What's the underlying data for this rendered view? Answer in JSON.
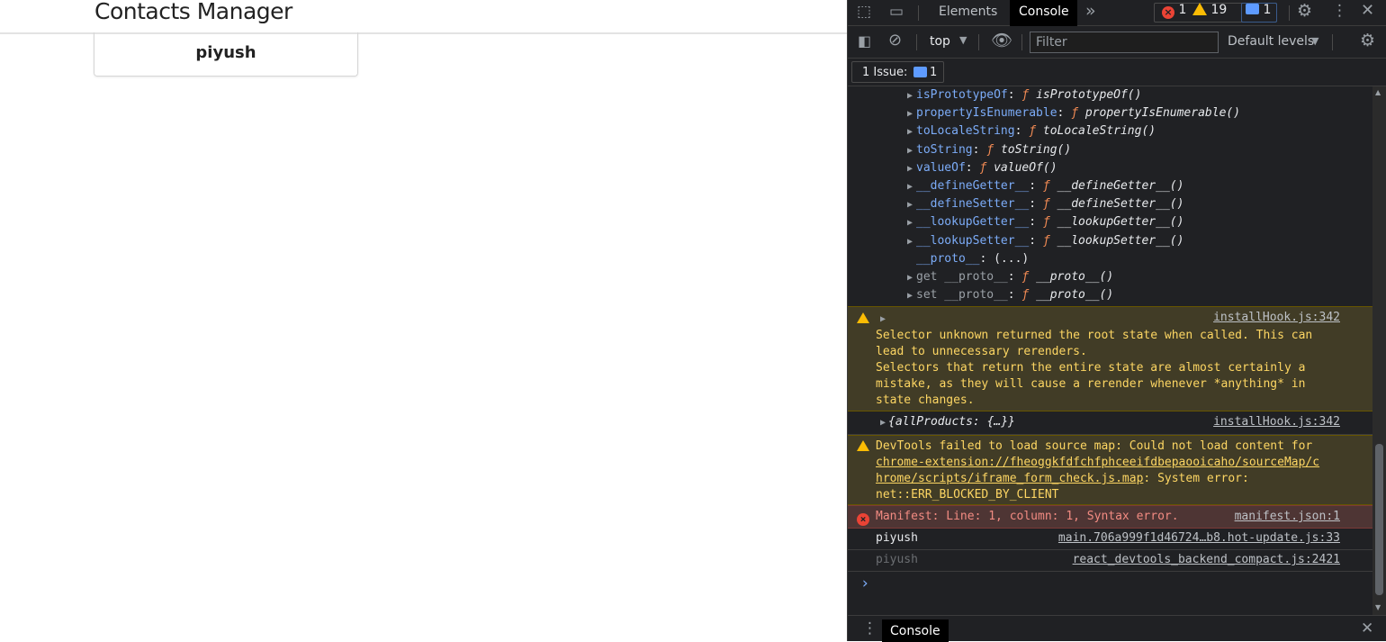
{
  "page": {
    "title": "Contacts Manager",
    "contact_name": "piyush"
  },
  "devtools": {
    "tabs": {
      "elements": "Elements",
      "console": "Console",
      "more": "»"
    },
    "counts": {
      "errors": "1",
      "warnings": "19",
      "messages": "1"
    },
    "toolbar": {
      "context": "top",
      "filter_placeholder": "Filter",
      "levels": "Default levels"
    },
    "issues": {
      "label": "1 Issue:",
      "count": "1"
    },
    "proto_lines": [
      {
        "key": "isPrototypeOf",
        "fn": "isPrototypeOf()"
      },
      {
        "key": "propertyIsEnumerable",
        "fn": "propertyIsEnumerable()"
      },
      {
        "key": "toLocaleString",
        "fn": "toLocaleString()"
      },
      {
        "key": "toString",
        "fn": "toString()"
      },
      {
        "key": "valueOf",
        "fn": "valueOf()"
      },
      {
        "key": "__defineGetter__",
        "fn": "__defineGetter__()"
      },
      {
        "key": "__defineSetter__",
        "fn": "__defineSetter__()"
      },
      {
        "key": "__lookupGetter__",
        "fn": "__lookupGetter__()"
      },
      {
        "key": "__lookupSetter__",
        "fn": "__lookupSetter__()"
      }
    ],
    "proto_plain": {
      "key": "__proto__",
      "value": "(...)"
    },
    "proto_accessors": [
      {
        "key": "get __proto__",
        "fn": "__proto__()"
      },
      {
        "key": "set __proto__",
        "fn": "__proto__()"
      }
    ],
    "fsym": "ƒ",
    "warning1": {
      "source": "installHook.js:342",
      "lines": [
        "Selector unknown returned the root state when called. This can",
        "lead to unnecessary rerenders.",
        "Selectors that return the entire state are almost certainly a",
        "mistake, as they will cause a rerender whenever *anything* in",
        "state changes."
      ]
    },
    "obj_line": {
      "text": "{allProducts: {…}}",
      "source": "installHook.js:342"
    },
    "warning2": {
      "prefix": "DevTools failed to load source map: Could not load content for",
      "url_line1": "chrome-extension://fheoggkfdfchfphceeifdbepaooicaho/sourceMap/c",
      "url_line2": "hrome/scripts/iframe_form_check.js.map",
      "suffix": ": System error:",
      "last_line": "net::ERR_BLOCKED_BY_CLIENT"
    },
    "error1": {
      "text": "Manifest: Line: 1, column: 1, Syntax error.",
      "source": "manifest.json:1"
    },
    "log1": {
      "text": "piyush",
      "source": "main.706a999f1d46724…b8.hot-update.js:33"
    },
    "log2": {
      "text": "piyush",
      "source": "react_devtools_backend_compact.js:2421"
    },
    "prompt": "›",
    "drawer": {
      "tab": "Console"
    },
    "colors": {
      "bg": "#202124",
      "warn_bg": "#413c26",
      "err_bg": "#4e3534",
      "key_blue": "#7cacf8",
      "fn_orange": "#f28b54"
    }
  }
}
